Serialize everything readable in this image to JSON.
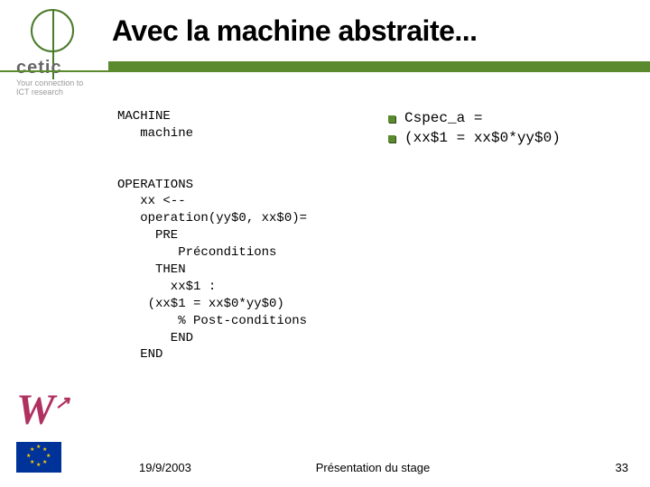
{
  "title": "Avec la machine abstraite...",
  "sidebar": {
    "brand": "cetic",
    "tagline1": "Your connection to",
    "tagline2": "ICT research",
    "logo_w": "W"
  },
  "code_block": "MACHINE\n   machine\n\n\nOPERATIONS\n   xx <--\n   operation(yy$0, xx$0)=\n     PRE\n        Préconditions\n     THEN\n       xx$1 :\n    (xx$1 = xx$0*yy$0)\n        % Post-conditions\n       END\n   END",
  "bullets": [
    "Cspec_a =",
    "(xx$1 = xx$0*yy$0)"
  ],
  "footer": {
    "date": "19/9/2003",
    "center": "Présentation du stage",
    "page": "33"
  }
}
